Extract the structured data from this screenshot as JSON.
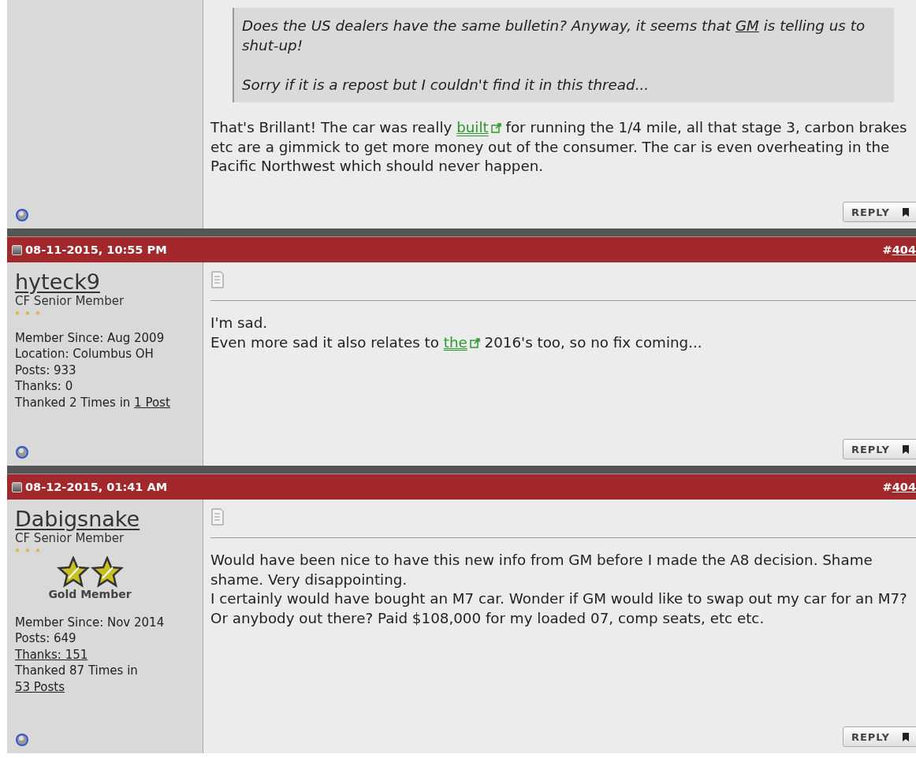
{
  "posts": [
    {
      "kind": "partial",
      "quote": {
        "paragraphs": [
          [
            {
              "text": "Does the US dealers have the same bulletin? Anyway, it seems that ",
              "kind": "text"
            },
            {
              "text": "GM",
              "kind": "link"
            },
            {
              "text": " is telling us to shut-up!",
              "kind": "text"
            }
          ],
          [
            {
              "text": "Sorry if it is a repost but I couldn't find it in this thread...",
              "kind": "text"
            }
          ]
        ]
      },
      "body": [
        [
          {
            "text": "That's Brillant! The car was really ",
            "kind": "text"
          },
          {
            "text": "built",
            "kind": "external"
          },
          {
            "text": " for running the 1/4 mile, all that stage 3, carbon brakes etc are a gimmick to get more money out of the consumer. The car is even overheating in the Pacific Northwest which should never happen.",
            "kind": "text"
          }
        ]
      ],
      "reply": "REPLY"
    },
    {
      "kind": "full",
      "date": "08-11-2015, 10:55 PM",
      "hash": "#",
      "number": "404",
      "user": {
        "name": "hyteck9",
        "title": "CF Senior Member",
        "stats": [
          [
            {
              "text": "Member Since: Aug 2009",
              "kind": "text"
            }
          ],
          [
            {
              "text": "Location: Columbus OH",
              "kind": "text"
            }
          ],
          [
            {
              "text": "Posts: 933",
              "kind": "text"
            }
          ],
          [
            {
              "text": "Thanks: 0",
              "kind": "text"
            }
          ],
          [
            {
              "text": "Thanked 2 Times in ",
              "kind": "text"
            },
            {
              "text": "1 Post",
              "kind": "link"
            }
          ]
        ]
      },
      "body": [
        [
          {
            "text": "I'm sad.",
            "kind": "text"
          }
        ],
        [
          {
            "text": "Even more sad it also relates to ",
            "kind": "text"
          },
          {
            "text": "the",
            "kind": "external"
          },
          {
            "text": " 2016's too, so no fix coming...",
            "kind": "text"
          }
        ]
      ],
      "reply": "REPLY"
    },
    {
      "kind": "full",
      "date": "08-12-2015, 01:41 AM",
      "hash": "#",
      "number": "404",
      "user": {
        "name": "Dabigsnake",
        "title": "CF Senior Member",
        "badge": "Gold Member",
        "stats": [
          [
            {
              "text": "Member Since: Nov 2014",
              "kind": "text"
            }
          ],
          [
            {
              "text": "Posts: 649",
              "kind": "text"
            }
          ],
          [
            {
              "text": "Thanks: 151",
              "kind": "link"
            }
          ],
          [
            {
              "text": "Thanked 87 Times in ",
              "kind": "text"
            },
            {
              "text": "53 Posts",
              "kind": "link"
            }
          ]
        ]
      },
      "body": [
        [
          {
            "text": "Would have been nice to have this new info from GM before I made the A8 decision. Shame shame. Very disappointing.",
            "kind": "text"
          }
        ],
        [
          {
            "text": "I certainly would have bought an M7 car. Wonder if GM would like to swap out my car for an M7? Or anybody out there? Paid $108,000 for my loaded 07, comp seats, etc etc.",
            "kind": "text"
          }
        ]
      ],
      "reply": "REPLY"
    }
  ]
}
